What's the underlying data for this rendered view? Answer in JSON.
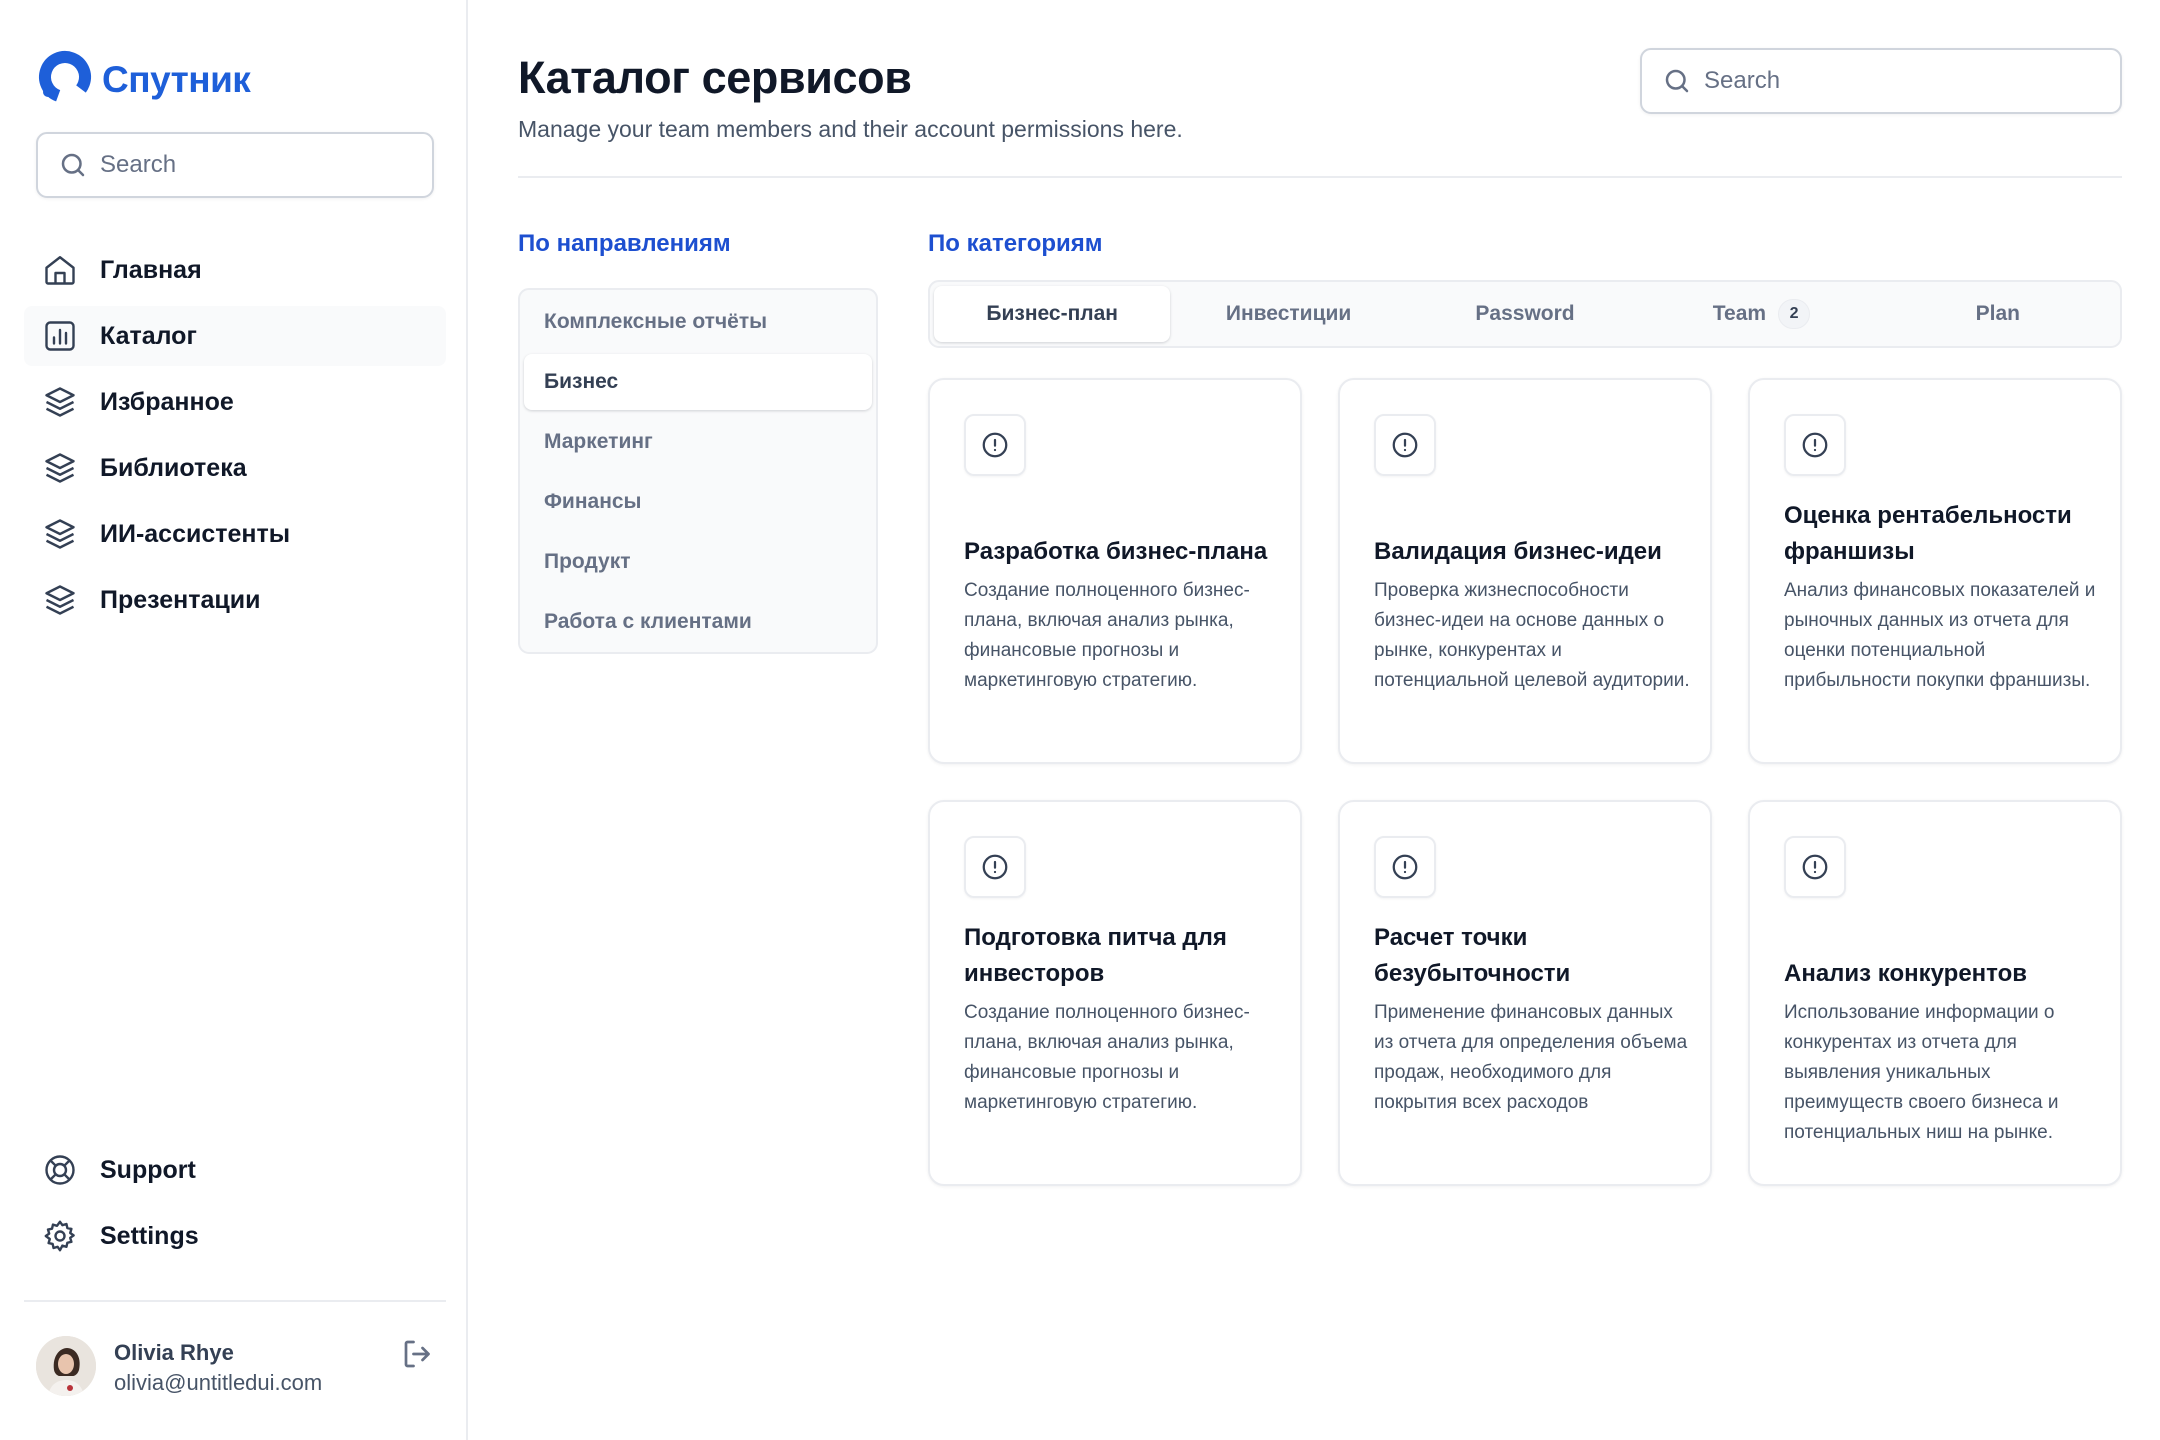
{
  "brand": {
    "name": "Спутник",
    "color": "#1e5fd9"
  },
  "sidebar": {
    "search_placeholder": "Search",
    "items": [
      {
        "label": "Главная",
        "icon": "home-icon",
        "active": false
      },
      {
        "label": "Каталог",
        "icon": "bar-chart-icon",
        "active": true
      },
      {
        "label": "Избранное",
        "icon": "layers-icon",
        "active": false
      },
      {
        "label": "Библиотека",
        "icon": "layers-icon",
        "active": false
      },
      {
        "label": "ИИ-ассистенты",
        "icon": "layers-icon",
        "active": false
      },
      {
        "label": "Презентации",
        "icon": "layers-icon",
        "active": false
      }
    ],
    "bottom_items": [
      {
        "label": "Support",
        "icon": "life-buoy-icon"
      },
      {
        "label": "Settings",
        "icon": "gear-icon"
      }
    ],
    "user": {
      "name": "Olivia Rhye",
      "email": "olivia@untitledui.com"
    }
  },
  "header": {
    "title": "Каталог сервисов",
    "subtitle": "Manage your team members and their account permissions here.",
    "search_placeholder": "Search"
  },
  "directions": {
    "title": "По направлениям",
    "items": [
      {
        "label": "Комплексные отчёты",
        "active": false
      },
      {
        "label": "Бизнес",
        "active": true
      },
      {
        "label": "Маркетинг",
        "active": false
      },
      {
        "label": "Финансы",
        "active": false
      },
      {
        "label": "Продукт",
        "active": false
      },
      {
        "label": "Работа с клиентами",
        "active": false
      }
    ]
  },
  "categories": {
    "title": "По категориям",
    "tabs": [
      {
        "label": "Бизнес-план",
        "active": true,
        "badge": ""
      },
      {
        "label": "Инвестиции",
        "active": false,
        "badge": ""
      },
      {
        "label": "Password",
        "active": false,
        "badge": ""
      },
      {
        "label": "Team",
        "active": false,
        "badge": "2"
      },
      {
        "label": "Plan",
        "active": false,
        "badge": ""
      }
    ]
  },
  "cards": [
    {
      "title": "Разработка бизнес-плана",
      "description": "Создание полноценного бизнес-плана, включая анализ рынка, финансовые прогнозы и маркетинговую стратегию.",
      "icon": "alert-circle-icon"
    },
    {
      "title": "Валидация бизнес-идеи",
      "description": "Проверка жизнеспособности бизнес-идеи на основе данных о рынке, конкурентах и потенциальной целевой аудитории.",
      "icon": "alert-circle-icon"
    },
    {
      "title": "Оценка рентабельности франшизы",
      "description": "Анализ финансовых показателей и рыночных данных из отчета для оценки потенциальной прибыльности покупки франшизы.",
      "icon": "alert-circle-icon"
    },
    {
      "title": "Подготовка питча для инвесторов",
      "description": "Создание полноценного бизнес-плана, включая анализ рынка, финансовые прогнозы и маркетинговую стратегию.",
      "icon": "alert-circle-icon"
    },
    {
      "title": "Расчет точки безубыточности",
      "description": "Применение финансовых данных из отчета для определения объема продаж, необходимого для покрытия всех расходов",
      "icon": "alert-circle-icon"
    },
    {
      "title": "Анализ конкурентов",
      "description": "Использование информации о конкурентах из отчета для выявления уникальных преимуществ своего бизнеса и потенциальных ниш на рынке.",
      "icon": "alert-circle-icon"
    }
  ]
}
